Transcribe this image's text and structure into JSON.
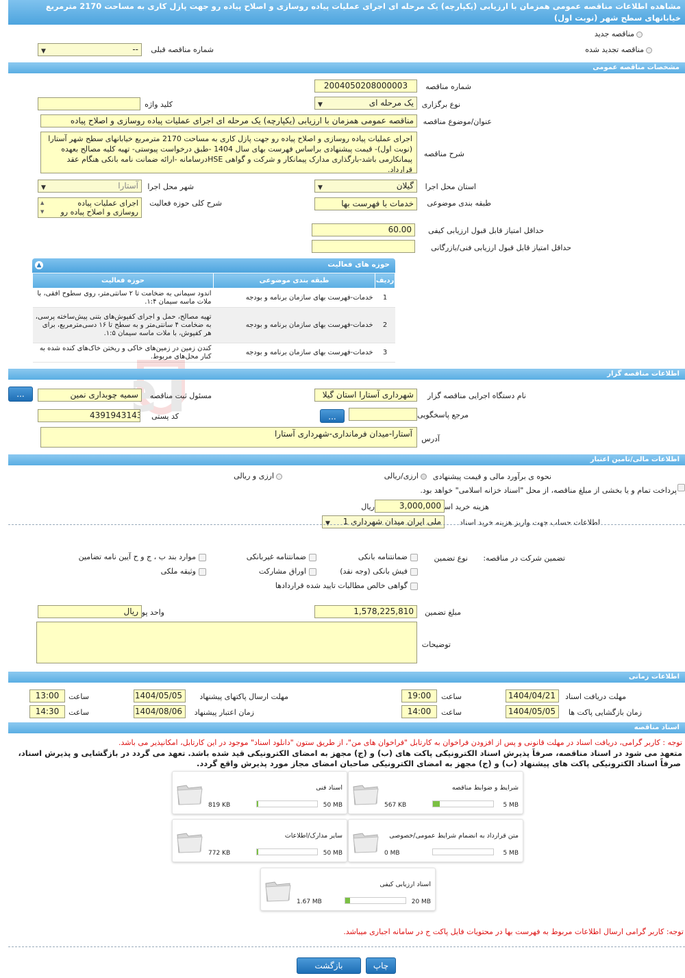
{
  "title": "مشاهده اطلاعات مناقصه عمومی همزمان با ارزیابی (یکپارچه) یک مرحله ای اجرای عملیات پیاده روسازی و اصلاح پیاده رو جهت پازل کاری به مساحت 2170 مترمربع خیابانهای سطح شهر (نوبت اول)",
  "top": {
    "new_tender": "مناقصه جدید",
    "renewed_tender": "مناقصه تجدید شده",
    "prev_number_label": "شماره مناقصه قبلی",
    "prev_number_value": "--"
  },
  "general": {
    "header": "مشخصات مناقصه عمومی",
    "number_label": "شماره مناقصه",
    "number_value": "2004050208000003",
    "type_label": "نوع برگزاری",
    "type_value": "یک مرحله ای",
    "keyword_label": "کلید واژه",
    "keyword_value": "",
    "subject_label": "عنوان/موضوع مناقصه",
    "subject_value": "مناقصه عمومی همزمان با ارزیابی (یکپارچه) یک مرحله ای اجرای عملیات پیاده روسازی و اصلاح پیاده",
    "desc_label": "شرح مناقصه",
    "desc_value": "اجرای عملیات پیاده روسازی و اصلاح پیاده رو جهت پازل کاری به مساحت 2170 مترمربع خیابانهای سطح شهر آستارا (نوبت اول)- قیمت پیشنهادی براساس فهرست بهای سال 1404 -طبق درخواست پیوستی- تهیه کلیه مصالح بعهده پیمانکارمی باشد-بارگذاری مدارک پیمانکار و شرکت و گواهی HSEدرسامانه -ارائه ضمانت نامه بانکی هنگام عقد قرارداد.",
    "province_label": "استان محل اجرا",
    "province_value": "گیلان",
    "city_label": "شهر محل اجرا",
    "city_value": "آستارا",
    "category_label": "طبقه بندی موضوعی",
    "category_value": "خدمات با فهرست بها",
    "scope_label": "شرح کلی حوزه فعالیت",
    "scope_value": "اجرای عملیات پیاده روسازی و اصلاح پیاده رو",
    "min_quality_label": "حداقل امتیاز قابل قبول ارزیابی کیفی",
    "min_quality_value": "60.00",
    "min_tech_label": "حداقل امتیاز قابل قبول ارزیابی فنی/بازرگانی",
    "min_tech_value": ""
  },
  "activities": {
    "title": "حوزه های فعالیت",
    "headers": {
      "row": "ردیف",
      "category": "طبقه بندی موضوعی",
      "scope": "حوزه فعالیت"
    },
    "rows": [
      {
        "n": "1",
        "category": "خدمات-فهرست بهای سازمان برنامه و بودجه",
        "scope": "اندود سیمانی به ضخامت تا ۲ سانتی‌متر، روی سطوح افقی، با ملات ماسه سیمان ۱:۴."
      },
      {
        "n": "2",
        "category": "خدمات-فهرست بهای سازمان برنامه و بودجه",
        "scope": "تهیه مصالح، حمل و اجرای کفپوش‌های بتنی پیش‌ساخته پرسی، به ضخامت ۴ سانتی‌متر و به سطح تا ۱۶ دسی‌مترمربع، برای هر کفپوش، با ملات ماسه سیمان ۱:۵."
      },
      {
        "n": "3",
        "category": "خدمات-فهرست بهای سازمان برنامه و بودجه",
        "scope": "کندن زمین در زمین‌های خاکی و ریختن خاک‌های کنده شده به کنار محل‌های مربوط."
      }
    ]
  },
  "organizer": {
    "header": "اطلاعات مناقصه گزار",
    "org_label": "نام دستگاه اجرایی مناقصه گزار",
    "org_value": "شهرداری آستارا استان گیلا",
    "official_label": "مسئول ثبت مناقصه",
    "official_value": "سمیه چوبداری نمین",
    "ref_label": "مرجع پاسخگویی",
    "ref_value": "",
    "postal_label": "کد پستی",
    "postal_value": "4391943143",
    "address_label": "آدرس",
    "address_value": "آستارا-میدان فرمانداری-شهرداری آستارا",
    "dots": "..."
  },
  "finance": {
    "header": "اطلاعات مالی/تامین اعتبار",
    "estimate_label": "نحوه ی برآورد مالی و قیمت پیشنهادی",
    "opt1": "ارزی/ریالی",
    "opt2": "ارزی و ریالی",
    "treasury_text": "پرداخت تمام و یا بخشی از مبلغ مناقصه، از محل \"اسناد خزانه اسلامی\" خواهد بود.",
    "doc_fee_label": "هزینه خرید اسناد",
    "doc_fee_value": "3,000,000",
    "doc_fee_unit": "ریال",
    "account_label": "اطلاعات حساب جهت واریز هزینه خرید اسناد",
    "account_value": "ملی ایران میدان شهرداری 1"
  },
  "guarantee": {
    "section_label": "تضمین شرکت در مناقصه:",
    "type_label": "نوع تضمین",
    "items": {
      "bank_guarantee": "ضمانتنامه بانکی",
      "nonbank_guarantee": "ضمانتنامه غیربانکی",
      "clauses": "موارد بند ب ، ج و ح آیین نامه تضامین",
      "bank_receipt": "فیش بانکی (وجه نقد)",
      "participation": "اوراق مشارکت",
      "property": "وثیقه ملکی",
      "claims": "گواهی خالص مطالبات تایید شده قراردادها"
    },
    "amount_label": "مبلغ تضمین",
    "amount_value": "1,578,225,810",
    "currency_label": "واحد پول",
    "currency_value": "ریال",
    "notes_label": "توضیحات",
    "notes_value": ""
  },
  "timing": {
    "header": "اطلاعات زمانی",
    "doc_receive_label": "مهلت دریافت اسناد",
    "doc_receive_date": "1404/04/21",
    "doc_receive_time": "19:00",
    "send_deadline_label": "مهلت ارسال پاکتهای پیشنهاد",
    "send_deadline_date": "1404/05/05",
    "send_deadline_time": "13:00",
    "opening_label": "زمان بازگشایی پاکت ها",
    "opening_date": "1404/05/05",
    "opening_time": "14:00",
    "validity_label": "زمان اعتبار پیشنهاد",
    "validity_date": "1404/08/06",
    "validity_time": "14:30",
    "time_label": "ساعت"
  },
  "documents": {
    "header": "اسناد مناقصه",
    "note_red": "توجه : کاربر گرامی، دریافت اسناد در مهلت قانونی و پس از افزودن فراخوان به کارتابل \"فراخوان های من\"، از طریق ستون \"دانلود اسناد\" موجود در این کارتابل، امکانپذیر می باشد.",
    "note_bold1": "متعهد می شود در اسناد مناقصه، صرفاً پذیرش اسناد الکترونیکی پاکت های (ب) و (ج) مجهز به امضای الکترونیکی قید شده باشد. تعهد می گردد در بازگشایی و پذیرش اسناد،",
    "note_bold2": "صرفاً اسناد الکترونیکی پاکت های پیشنهاد (ب) و (ج) مجهز به امضای الکترونیکی صاحبان امضای مجاز مورد پذیرش واقع گردد.",
    "files": [
      {
        "name": "شرایط و ضوابط مناقصه",
        "size": "567 KB",
        "max": "5 MB",
        "fill": 0.11
      },
      {
        "name": "اسناد فنی",
        "size": "819 KB",
        "max": "50 MB",
        "fill": 0.02
      },
      {
        "name": "متن قرارداد به انضمام شرایط عمومی/خصوصی",
        "size": "0 MB",
        "max": "5 MB",
        "fill": 0
      },
      {
        "name": "سایر مدارک/اطلاعات",
        "size": "772 KB",
        "max": "50 MB",
        "fill": 0.02
      },
      {
        "name": "اسناد ارزیابی کیفی",
        "size": "1.67 MB",
        "max": "20 MB",
        "fill": 0.08
      }
    ],
    "note_red2": "توجه: کاربر گرامی ارسال اطلاعات مربوط به فهرست بها در محتویات فایل پاکت ج در سامانه اجباری میباشد."
  },
  "buttons": {
    "print": "چاپ",
    "back": "بازگشت"
  },
  "watermark": "AriaTender.neT"
}
